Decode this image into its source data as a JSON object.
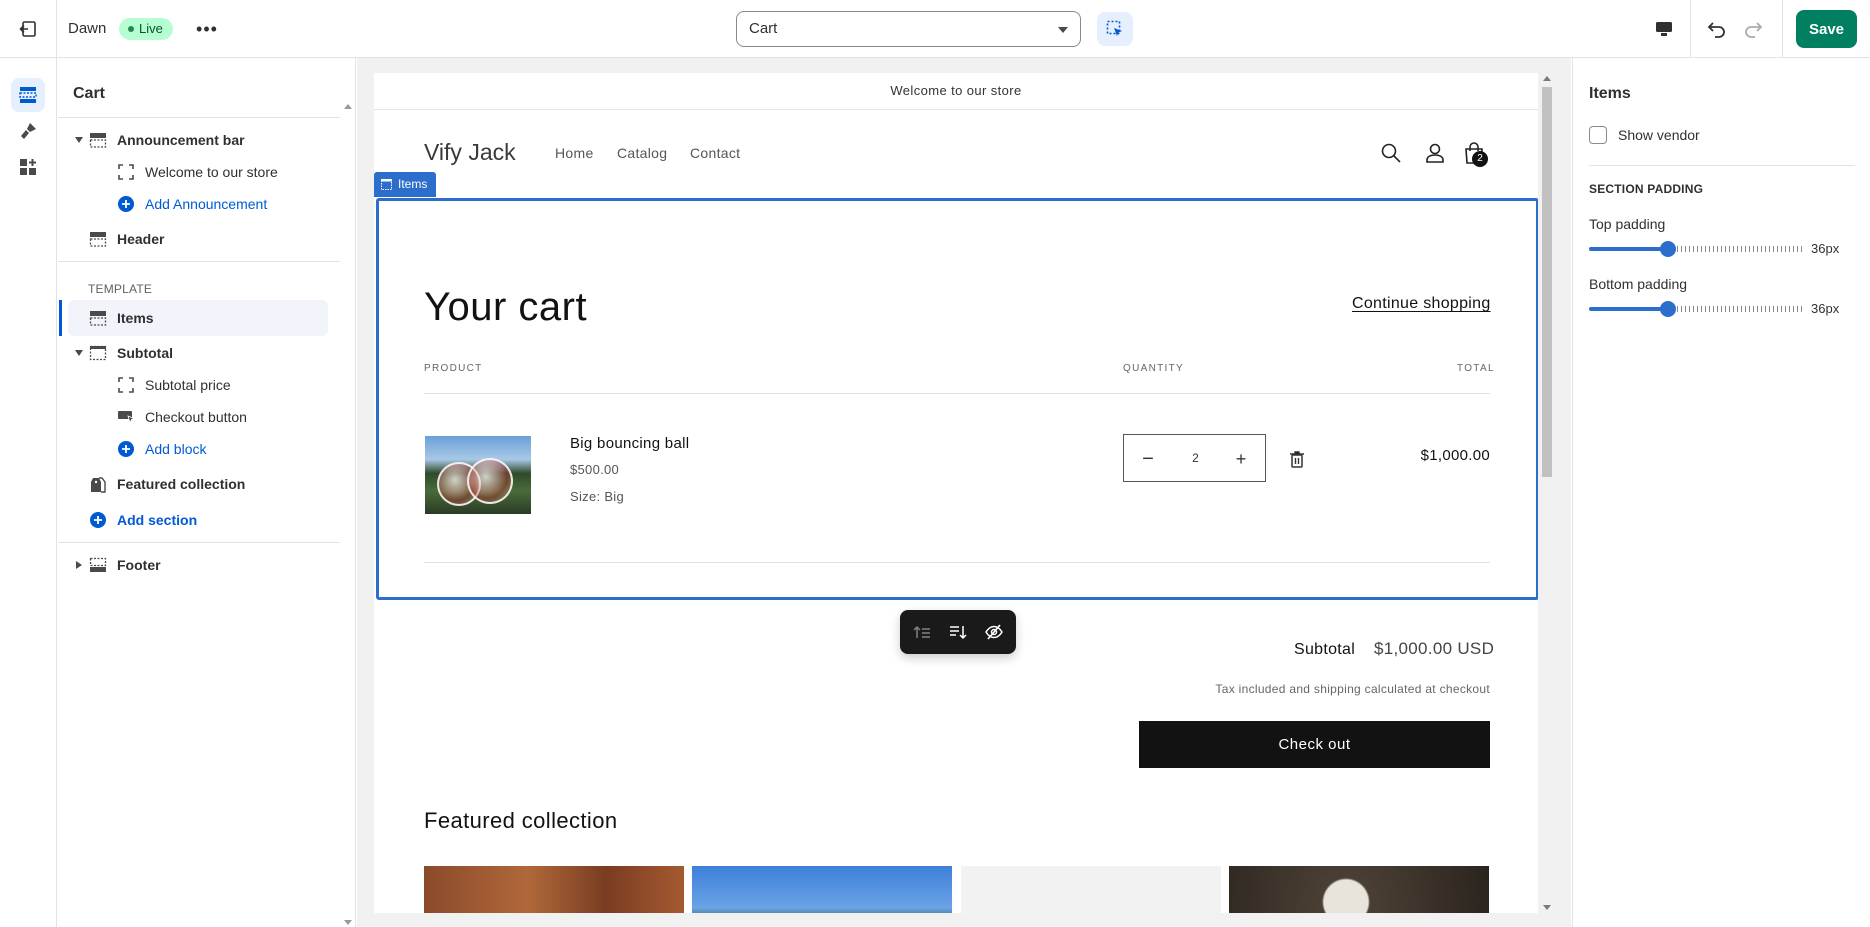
{
  "topbar": {
    "theme_name": "Dawn",
    "status_badge": "Live",
    "more_label": "•••",
    "template_select": "Cart",
    "save_label": "Save"
  },
  "sidebar": {
    "title": "Cart",
    "template_label": "TEMPLATE",
    "items": [
      {
        "label": "Announcement bar"
      },
      {
        "label": "Welcome to our store"
      },
      {
        "label": "Add Announcement"
      },
      {
        "label": "Header"
      },
      {
        "label": "Items"
      },
      {
        "label": "Subtotal"
      },
      {
        "label": "Subtotal price"
      },
      {
        "label": "Checkout button"
      },
      {
        "label": "Add block"
      },
      {
        "label": "Featured collection"
      },
      {
        "label": "Add section"
      },
      {
        "label": "Footer"
      }
    ]
  },
  "preview": {
    "announcement": "Welcome to our store",
    "store_name": "Vify Jack",
    "nav": [
      "Home",
      "Catalog",
      "Contact"
    ],
    "cart_count": "2",
    "selection_tag": "Items",
    "cart_title": "Your cart",
    "continue_shopping": "Continue shopping",
    "columns": {
      "product": "PRODUCT",
      "quantity": "QUANTITY",
      "total": "TOTAL"
    },
    "line_item": {
      "name": "Big bouncing ball",
      "price": "$500.00",
      "size": "Size: Big",
      "quantity": "2",
      "total": "$1,000.00"
    },
    "subtotal_label": "Subtotal",
    "subtotal_value": "$1,000.00 USD",
    "tax_note": "Tax included and shipping calculated at checkout",
    "checkout_label": "Check out",
    "featured_title": "Featured collection",
    "colors": {
      "checkout_bg": "#121212",
      "selection": "#2c6ecb"
    }
  },
  "right_panel": {
    "title": "Items",
    "show_vendor_label": "Show vendor",
    "show_vendor_checked": false,
    "section_padding_label": "SECTION PADDING",
    "top_padding_label": "Top padding",
    "top_padding_value": "36px",
    "bottom_padding_label": "Bottom padding",
    "bottom_padding_value": "36px"
  },
  "colors": {
    "save": "#008060",
    "accent": "#005bd3",
    "live_badge": "#b4fed2"
  }
}
